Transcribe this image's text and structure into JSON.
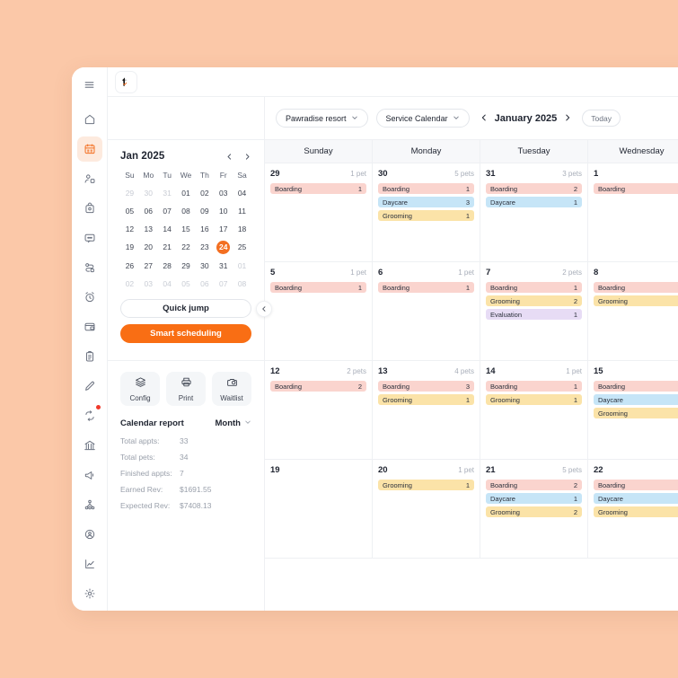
{
  "theme": {
    "page_bg": "#fbc8a8",
    "accent": "#f36f21",
    "primary_button": "#f96e14",
    "badge_red": "#f0392b"
  },
  "rail": {
    "menu_icon": "hamburger-icon",
    "items": [
      {
        "icon": "home-icon",
        "name": "home",
        "active": false
      },
      {
        "icon": "calendar-icon",
        "name": "calendar",
        "active": true
      },
      {
        "icon": "clients-icon",
        "name": "clients",
        "active": false
      },
      {
        "icon": "pets-icon",
        "name": "pets",
        "active": false
      },
      {
        "icon": "messages-icon",
        "name": "messages",
        "active": false
      },
      {
        "icon": "workflow-icon",
        "name": "workflow",
        "active": false
      },
      {
        "icon": "alarm-icon",
        "name": "reminders",
        "active": false
      },
      {
        "icon": "payments-icon",
        "name": "payments",
        "active": false
      },
      {
        "icon": "clipboard-icon",
        "name": "forms",
        "active": false
      },
      {
        "icon": "pencil-icon",
        "name": "notes",
        "active": false
      },
      {
        "icon": "repeat-icon",
        "name": "recurring",
        "active": false,
        "badge": true
      },
      {
        "icon": "bank-icon",
        "name": "bank",
        "active": false
      },
      {
        "icon": "megaphone-icon",
        "name": "marketing",
        "active": false
      },
      {
        "icon": "network-icon",
        "name": "team",
        "active": false
      },
      {
        "icon": "badge-icon",
        "name": "staff",
        "active": false
      },
      {
        "icon": "chart-icon",
        "name": "reports",
        "active": false
      },
      {
        "icon": "gear-icon",
        "name": "settings",
        "active": false
      }
    ]
  },
  "topbar": {
    "logo_icon": "pet-logo-icon"
  },
  "mini_calendar": {
    "title": "Jan 2025",
    "prev_icon": "chevron-left-icon",
    "next_icon": "chevron-right-icon",
    "dow": [
      "Su",
      "Mo",
      "Tu",
      "We",
      "Th",
      "Fr",
      "Sa"
    ],
    "weeks": [
      [
        {
          "d": "29",
          "mute": true
        },
        {
          "d": "30",
          "mute": true
        },
        {
          "d": "31",
          "mute": true
        },
        {
          "d": "01"
        },
        {
          "d": "02"
        },
        {
          "d": "03"
        },
        {
          "d": "04"
        }
      ],
      [
        {
          "d": "05"
        },
        {
          "d": "06"
        },
        {
          "d": "07"
        },
        {
          "d": "08"
        },
        {
          "d": "09"
        },
        {
          "d": "10"
        },
        {
          "d": "11"
        }
      ],
      [
        {
          "d": "12"
        },
        {
          "d": "13"
        },
        {
          "d": "14"
        },
        {
          "d": "15"
        },
        {
          "d": "16"
        },
        {
          "d": "17"
        },
        {
          "d": "18"
        }
      ],
      [
        {
          "d": "19"
        },
        {
          "d": "20"
        },
        {
          "d": "21"
        },
        {
          "d": "22"
        },
        {
          "d": "23"
        },
        {
          "d": "24",
          "selected": true
        },
        {
          "d": "25"
        }
      ],
      [
        {
          "d": "26"
        },
        {
          "d": "27"
        },
        {
          "d": "28"
        },
        {
          "d": "29"
        },
        {
          "d": "30"
        },
        {
          "d": "31"
        },
        {
          "d": "01",
          "mute": true
        }
      ],
      [
        {
          "d": "02",
          "mute": true
        },
        {
          "d": "03",
          "mute": true
        },
        {
          "d": "04",
          "mute": true
        },
        {
          "d": "05",
          "mute": true
        },
        {
          "d": "06",
          "mute": true
        },
        {
          "d": "07",
          "mute": true
        },
        {
          "d": "08",
          "mute": true
        }
      ]
    ]
  },
  "left_buttons": {
    "quick_jump": "Quick jump",
    "smart_scheduling": "Smart scheduling"
  },
  "tiles": [
    {
      "label": "Config",
      "icon": "layers-icon"
    },
    {
      "label": "Print",
      "icon": "printer-icon"
    },
    {
      "label": "Waitlist",
      "icon": "waitlist-camera-icon"
    }
  ],
  "report": {
    "title": "Calendar report",
    "range": "Month",
    "range_icon": "chevron-down-icon",
    "rows": [
      {
        "key": "Total appts:",
        "value": "33"
      },
      {
        "key": "Total pets:",
        "value": "34"
      },
      {
        "key": "Finished appts:",
        "value": "7"
      },
      {
        "key": "Earned Rev:",
        "value": "$1691.55"
      },
      {
        "key": "Expected Rev:",
        "value": "$7408.13"
      }
    ]
  },
  "collapse": {
    "icon": "chevron-left-icon"
  },
  "cal_toolbar": {
    "location": "Pawradise resort",
    "location_icon": "chevron-down-icon",
    "view": "Service Calendar",
    "view_icon": "chevron-down-icon",
    "prev_icon": "chevron-left-icon",
    "next_icon": "chevron-right-icon",
    "month": "January 2025",
    "today": "Today"
  },
  "calendar": {
    "day_headers": [
      "Sunday",
      "Monday",
      "Tuesday",
      "Wednesday"
    ],
    "weeks": [
      [
        {
          "date": "29",
          "count": "1 pet",
          "events": [
            {
              "label": "Boarding",
              "n": "1",
              "type": "boarding"
            }
          ]
        },
        {
          "date": "30",
          "count": "5 pets",
          "events": [
            {
              "label": "Boarding",
              "n": "1",
              "type": "boarding"
            },
            {
              "label": "Daycare",
              "n": "3",
              "type": "daycare"
            },
            {
              "label": "Grooming",
              "n": "1",
              "type": "grooming"
            }
          ]
        },
        {
          "date": "31",
          "count": "3 pets",
          "events": [
            {
              "label": "Boarding",
              "n": "2",
              "type": "boarding"
            },
            {
              "label": "Daycare",
              "n": "1",
              "type": "daycare"
            }
          ]
        },
        {
          "date": "1",
          "count": "",
          "events": [
            {
              "label": "Boarding",
              "n": "",
              "type": "boarding"
            }
          ]
        }
      ],
      [
        {
          "date": "5",
          "count": "1 pet",
          "events": [
            {
              "label": "Boarding",
              "n": "1",
              "type": "boarding"
            }
          ]
        },
        {
          "date": "6",
          "count": "1 pet",
          "events": [
            {
              "label": "Boarding",
              "n": "1",
              "type": "boarding"
            }
          ]
        },
        {
          "date": "7",
          "count": "2 pets",
          "events": [
            {
              "label": "Boarding",
              "n": "1",
              "type": "boarding"
            },
            {
              "label": "Grooming",
              "n": "2",
              "type": "grooming"
            },
            {
              "label": "Evaluation",
              "n": "1",
              "type": "evaluation"
            }
          ]
        },
        {
          "date": "8",
          "count": "",
          "events": [
            {
              "label": "Boarding",
              "n": "",
              "type": "boarding"
            },
            {
              "label": "Grooming",
              "n": "",
              "type": "grooming"
            }
          ]
        }
      ],
      [
        {
          "date": "12",
          "count": "2 pets",
          "events": [
            {
              "label": "Boarding",
              "n": "2",
              "type": "boarding"
            }
          ]
        },
        {
          "date": "13",
          "count": "4 pets",
          "events": [
            {
              "label": "Boarding",
              "n": "3",
              "type": "boarding"
            },
            {
              "label": "Grooming",
              "n": "1",
              "type": "grooming"
            }
          ]
        },
        {
          "date": "14",
          "count": "1 pet",
          "events": [
            {
              "label": "Boarding",
              "n": "1",
              "type": "boarding"
            },
            {
              "label": "Grooming",
              "n": "1",
              "type": "grooming"
            }
          ]
        },
        {
          "date": "15",
          "count": "",
          "events": [
            {
              "label": "Boarding",
              "n": "",
              "type": "boarding"
            },
            {
              "label": "Daycare",
              "n": "",
              "type": "daycare"
            },
            {
              "label": "Grooming",
              "n": "",
              "type": "grooming"
            }
          ]
        }
      ],
      [
        {
          "date": "19",
          "count": "",
          "events": []
        },
        {
          "date": "20",
          "count": "1 pet",
          "events": [
            {
              "label": "Grooming",
              "n": "1",
              "type": "grooming"
            }
          ]
        },
        {
          "date": "21",
          "count": "5 pets",
          "events": [
            {
              "label": "Boarding",
              "n": "2",
              "type": "boarding"
            },
            {
              "label": "Daycare",
              "n": "1",
              "type": "daycare"
            },
            {
              "label": "Grooming",
              "n": "2",
              "type": "grooming"
            }
          ]
        },
        {
          "date": "22",
          "count": "",
          "events": [
            {
              "label": "Boarding",
              "n": "",
              "type": "boarding"
            },
            {
              "label": "Daycare",
              "n": "",
              "type": "daycare"
            },
            {
              "label": "Grooming",
              "n": "",
              "type": "grooming"
            }
          ]
        }
      ]
    ]
  }
}
